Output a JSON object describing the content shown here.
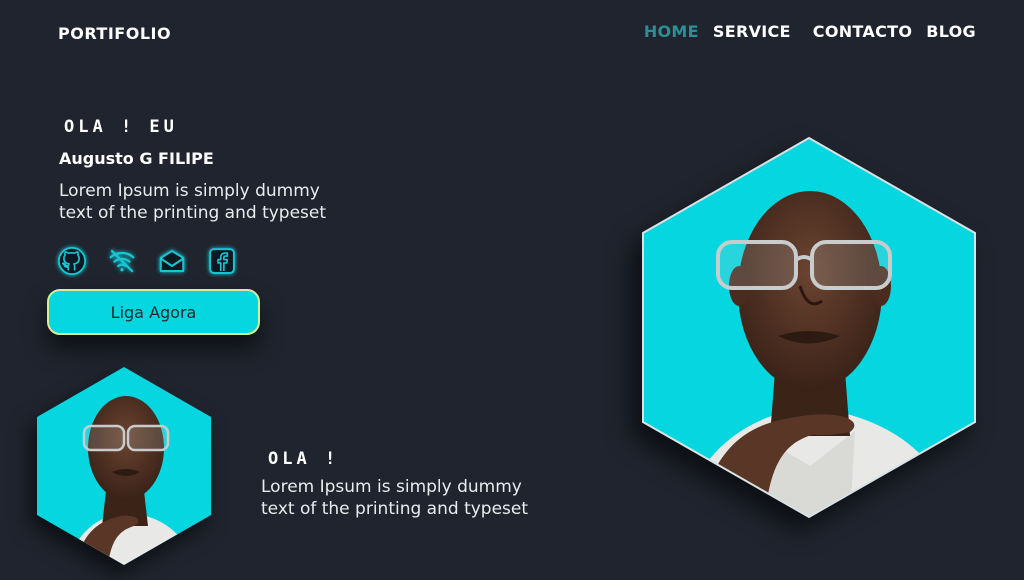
{
  "header": {
    "logo": "PORTIFOLIO",
    "nav": [
      {
        "label": "HOME",
        "active": true
      },
      {
        "label": "SERVICE",
        "active": false
      },
      {
        "label": "CONTACTO",
        "active": false
      },
      {
        "label": "BLOG",
        "active": false
      }
    ]
  },
  "hero": {
    "greeting": "OLA ! EU",
    "name": "Augusto G FILIPE",
    "description": "Lorem Ipsum is simply dummy text of the printing and typeset",
    "socials": [
      "github-icon",
      "wifi-icon",
      "mail-icon",
      "facebook-icon"
    ],
    "cta_label": "Liga Agora"
  },
  "section": {
    "greeting": "OLA !",
    "description": "Lorem Ipsum is simply dummy text of the printing and typeset"
  },
  "colors": {
    "background": "#1f242e",
    "accent": "#06d6e0",
    "nav_active": "#2a8f96",
    "button_border": "#d4ec9c"
  }
}
